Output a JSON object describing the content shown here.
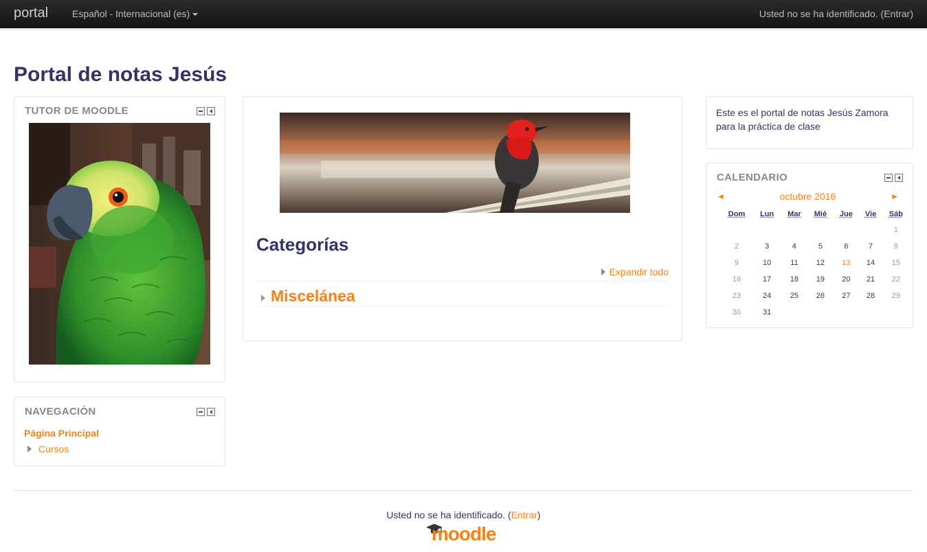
{
  "navbar": {
    "brand": "portal",
    "language": "Español - Internacional (es)",
    "login_text": "Usted no se ha identificado. (",
    "login_link": "Entrar",
    "login_close": ")"
  },
  "page_title": "Portal de notas Jesús",
  "blocks": {
    "tutor": {
      "title": "TUTOR DE MOODLE"
    },
    "navigation": {
      "title": "NAVEGACIÓN",
      "home": "Página Principal",
      "courses": "Cursos"
    },
    "html_text": "Este es el portal de notas Jesús Zamora para la práctica de clase",
    "calendar": {
      "title": "CALENDARIO",
      "prev": "◄",
      "next": "►",
      "month": "octubre 2016",
      "days": [
        "Dom",
        "Lun",
        "Mar",
        "Mié",
        "Jue",
        "Vie",
        "Sáb"
      ],
      "weeks": [
        [
          "",
          "",
          "",
          "",
          "",
          "",
          "1"
        ],
        [
          "2",
          "3",
          "4",
          "5",
          "6",
          "7",
          "8"
        ],
        [
          "9",
          "10",
          "11",
          "12",
          "13",
          "14",
          "15"
        ],
        [
          "16",
          "17",
          "18",
          "19",
          "20",
          "21",
          "22"
        ],
        [
          "23",
          "24",
          "25",
          "26",
          "27",
          "28",
          "29"
        ],
        [
          "30",
          "31",
          "",
          "",
          "",
          "",
          ""
        ]
      ],
      "today": "13"
    }
  },
  "main": {
    "categories_title": "Categorías",
    "expand_all": "Expandir todo",
    "category": "Miscelánea"
  },
  "footer": {
    "login_text": "Usted no se ha identificado. (",
    "login_link": "Entrar",
    "login_close": ")",
    "logo_text": "moodle"
  },
  "colors": {
    "accent": "#f98012",
    "text": "#333366"
  }
}
